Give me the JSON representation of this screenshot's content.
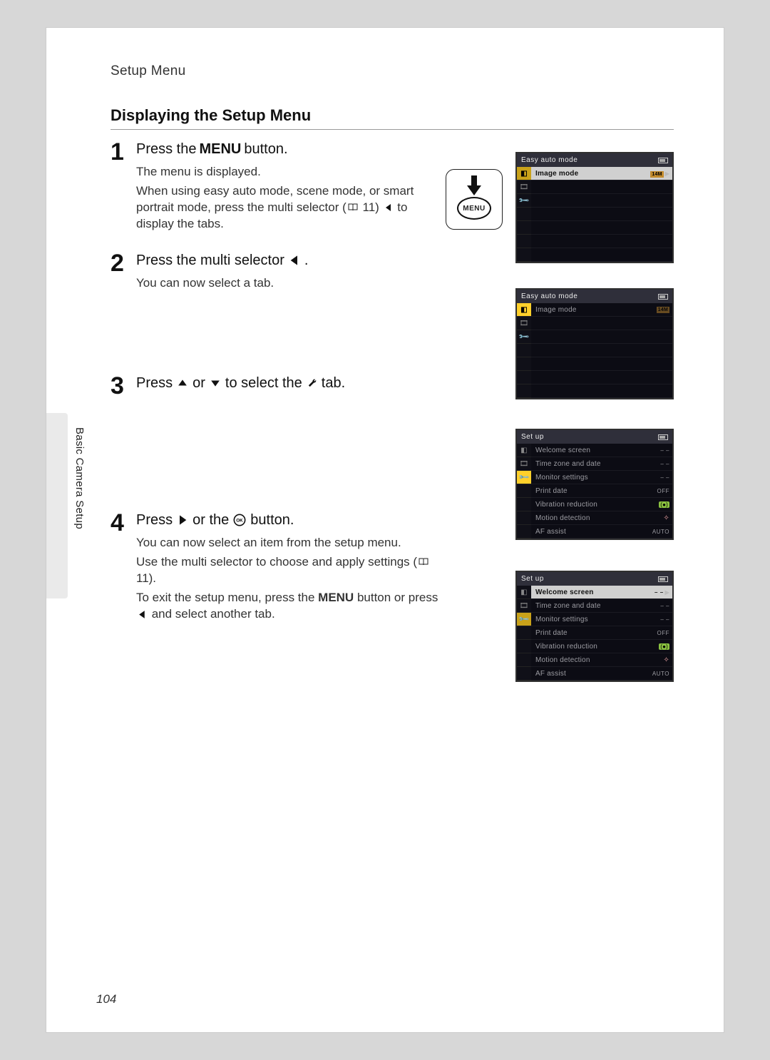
{
  "section_label": "Setup Menu",
  "title": "Displaying the Setup Menu",
  "sidebar_tab": "Basic Camera Setup",
  "page_number": "104",
  "menu_word": "MENU",
  "book_ref": "11",
  "steps": {
    "s1": {
      "num": "1",
      "heading_pre": "Press the ",
      "heading_menu": "MENU",
      "heading_post": " button.",
      "p1": "The menu is displayed.",
      "p2a": "When using easy auto mode, scene mode, or smart portrait mode, press the multi selector (",
      "p2b": " 11) ",
      "p2c": " to display the tabs."
    },
    "s2": {
      "num": "2",
      "heading_a": "Press the multi selector ",
      "heading_b": ".",
      "p1": "You can now select a tab."
    },
    "s3": {
      "num": "3",
      "heading_a": "Press ",
      "heading_b": " or ",
      "heading_c": " to select the ",
      "heading_d": " tab."
    },
    "s4": {
      "num": "4",
      "heading_a": "Press ",
      "heading_b": " or the ",
      "heading_c": " button.",
      "p1": "You can now select an item from the setup menu.",
      "p2a": "Use the multi selector to choose and apply settings (",
      "p2b": " 11).",
      "p3a": "To exit the setup menu, press the ",
      "p3b": " button or press ",
      "p3c": " and select another tab."
    }
  },
  "screens": {
    "easy": {
      "title": "Easy auto mode",
      "image_mode": "Image mode",
      "badge": "14M"
    },
    "setup": {
      "title": "Set up",
      "rows": [
        {
          "label": "Welcome screen",
          "val": "– –"
        },
        {
          "label": "Time zone and date",
          "val": "– –"
        },
        {
          "label": "Monitor settings",
          "val": "– –"
        },
        {
          "label": "Print date",
          "val": "OFF"
        },
        {
          "label": "Vibration reduction",
          "val": "VR"
        },
        {
          "label": "Motion detection",
          "val": "MD"
        },
        {
          "label": "AF assist",
          "val": "AUTO"
        }
      ]
    }
  }
}
